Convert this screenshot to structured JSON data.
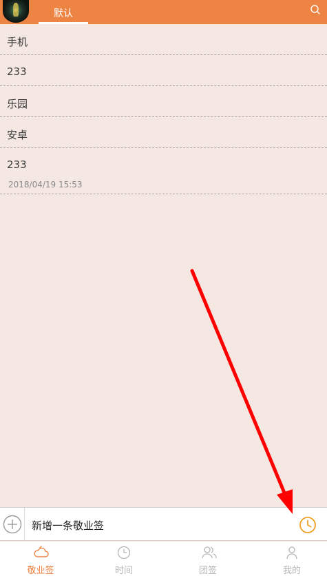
{
  "header": {
    "tab_label": "默认",
    "background": "#ee8443"
  },
  "notes": [
    {
      "text": "手机"
    },
    {
      "text": "233"
    },
    {
      "text": "乐园"
    },
    {
      "text": "安卓"
    },
    {
      "text": "233",
      "date": "2018/04/19 15:53"
    }
  ],
  "add_bar": {
    "placeholder": "新增一条敬业签"
  },
  "tabbar": {
    "items": [
      {
        "label": "敬业签",
        "icon": "cloud-icon",
        "active": true
      },
      {
        "label": "时间",
        "icon": "clock-icon",
        "active": false
      },
      {
        "label": "团签",
        "icon": "group-icon",
        "active": false
      },
      {
        "label": "我的",
        "icon": "person-icon",
        "active": false
      }
    ]
  },
  "colors": {
    "accent": "#ee8443",
    "background": "#f5e8e3",
    "clock": "#f0a020",
    "annotation_arrow": "#ff0000"
  }
}
